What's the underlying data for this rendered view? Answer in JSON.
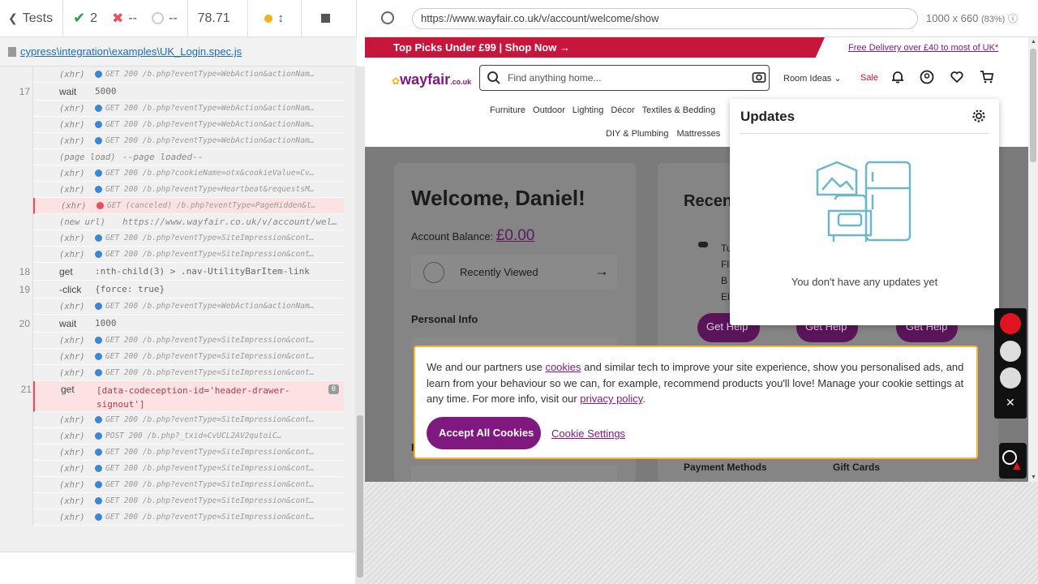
{
  "runner": {
    "tests_label": "Tests",
    "passed": "2",
    "failed": "--",
    "pending": "--",
    "duration": "78.71",
    "spec_path": "cypress\\integration\\examples\\UK_Login.spec.js"
  },
  "commands": [
    {
      "num": "",
      "name": "(xhr)",
      "msg": "GET 200 /b.php?eventType=WebAction&actionNam…",
      "dot": "blue",
      "type": "xhr"
    },
    {
      "num": "17",
      "name": "wait",
      "msg": "5000",
      "type": "cmd"
    },
    {
      "num": "",
      "name": "(xhr)",
      "msg": "GET 200 /b.php?eventType=WebAction&actionNam…",
      "dot": "blue",
      "type": "xhr"
    },
    {
      "num": "",
      "name": "(xhr)",
      "msg": "GET 200 /b.php?eventType=WebAction&actionNam…",
      "dot": "blue",
      "type": "xhr"
    },
    {
      "num": "",
      "name": "(xhr)",
      "msg": "GET 200 /b.php?eventType=WebAction&actionNam…",
      "dot": "blue",
      "type": "xhr"
    },
    {
      "num": "",
      "name": "(page load)",
      "msg": "--page loaded--",
      "type": "event"
    },
    {
      "num": "",
      "name": "(xhr)",
      "msg": "GET 200 /b.php?cookieName=otx&cookieValue=Cv…",
      "dot": "blue",
      "type": "xhr"
    },
    {
      "num": "",
      "name": "(xhr)",
      "msg": "GET 200 /b.php?eventType=Heartbeat&requestsM…",
      "dot": "blue",
      "type": "xhr"
    },
    {
      "num": "",
      "name": "(xhr)",
      "msg": "GET (canceled) /b.php?eventType=PageHidden&t…",
      "dot": "red",
      "type": "xhr",
      "err": true
    },
    {
      "num": "",
      "name": "(new url)",
      "msg": "https://www.wayfair.co.uk/v/account/wel…",
      "type": "event"
    },
    {
      "num": "",
      "name": "(xhr)",
      "msg": "GET 200 /b.php?eventType=SiteImpression&cont…",
      "dot": "blue",
      "type": "xhr"
    },
    {
      "num": "",
      "name": "(xhr)",
      "msg": "GET 200 /b.php?eventType=SiteImpression&cont…",
      "dot": "blue",
      "type": "xhr"
    },
    {
      "num": "18",
      "name": "get",
      "msg": ":nth-child(3) > .nav-UtilityBarItem-link",
      "type": "cmd"
    },
    {
      "num": "19",
      "name": "-click",
      "msg": "{force: true}",
      "type": "cmd"
    },
    {
      "num": "",
      "name": "(xhr)",
      "msg": "GET 200 /b.php?eventType=WebAction&actionNam…",
      "dot": "blue",
      "type": "xhr"
    },
    {
      "num": "20",
      "name": "wait",
      "msg": "1000",
      "type": "cmd"
    },
    {
      "num": "",
      "name": "(xhr)",
      "msg": "GET 200 /b.php?eventType=SiteImpression&cont…",
      "dot": "blue",
      "type": "xhr"
    },
    {
      "num": "",
      "name": "(xhr)",
      "msg": "GET 200 /b.php?eventType=SiteImpression&cont…",
      "dot": "blue",
      "type": "xhr"
    },
    {
      "num": "",
      "name": "(xhr)",
      "msg": "GET 200 /b.php?eventType=SiteImpression&cont…",
      "dot": "blue",
      "type": "xhr"
    },
    {
      "num": "21",
      "name": "get",
      "msg": "[data-codeception-id='header-drawer-signout']",
      "type": "cmd",
      "err": true,
      "badge": "0"
    },
    {
      "num": "",
      "name": "(xhr)",
      "msg": "GET 200 /b.php?eventType=SiteImpression&cont…",
      "dot": "blue",
      "type": "xhr"
    },
    {
      "num": "",
      "name": "(xhr)",
      "msg": "POST 200 /b.php?_txid=CvUCL2AV2qutoiC…",
      "dot": "blue",
      "type": "xhr"
    },
    {
      "num": "",
      "name": "(xhr)",
      "msg": "GET 200 /b.php?eventType=SiteImpression&cont…",
      "dot": "blue",
      "type": "xhr"
    },
    {
      "num": "",
      "name": "(xhr)",
      "msg": "GET 200 /b.php?eventType=SiteImpression&cont…",
      "dot": "blue",
      "type": "xhr"
    },
    {
      "num": "",
      "name": "(xhr)",
      "msg": "GET 200 /b.php?eventType=SiteImpression&cont…",
      "dot": "blue",
      "type": "xhr"
    },
    {
      "num": "",
      "name": "(xhr)",
      "msg": "GET 200 /b.php?eventType=SiteImpression&cont…",
      "dot": "blue",
      "type": "xhr"
    },
    {
      "num": "",
      "name": "(xhr)",
      "msg": "GET 200 /b.php?eventType=SiteImpression&cont…",
      "dot": "blue",
      "type": "xhr"
    }
  ],
  "browser": {
    "url": "https://www.wayfair.co.uk/v/account/welcome/show",
    "viewport": "1000 x 660",
    "scale": "(83%)"
  },
  "site": {
    "promo": "Top Picks Under £99 | Shop Now",
    "free_delivery": "Free Delivery over £40 to most of UK*",
    "logo": "wayfair",
    "logo_tld": ".co.uk",
    "search_placeholder": "Find anything home...",
    "room_ideas": "Room Ideas",
    "sale": "Sale",
    "nav1": [
      "Furniture",
      "Outdoor",
      "Lighting",
      "Décor",
      "Textiles & Bedding"
    ],
    "nav2": [
      "DIY & Plumbing",
      "Mattresses"
    ],
    "welcome": "Welcome, Daniel!",
    "balance_label": "Account Balance:",
    "balance_value": "£0.00",
    "recently_viewed": "Recently Viewed",
    "personal_info": "Personal Info",
    "recent_heading": "Recen",
    "recent_lines": [
      "Tu",
      "Fl",
      "B",
      "El"
    ],
    "get_help": "Get Help",
    "payment_methods": "Payment Methods",
    "gift_cards": "Gift Cards",
    "partial_label": "R"
  },
  "updates": {
    "title": "Updates",
    "message": "You don't have any updates yet"
  },
  "cookie": {
    "text_1": "We and our partners use ",
    "link_cookies": "cookies",
    "text_2": " and similar tech to improve your site experience, show you personalised ads, and learn from your behaviour so we can, for example, recommend products you'll love! Manage your cookie settings at any time. For more info, visit our ",
    "link_privacy": "privacy policy",
    "text_3": ".",
    "accept": "Accept All Cookies",
    "settings": "Cookie Settings"
  },
  "colors": {
    "brand": "#7f187f",
    "promo": "#c7163c",
    "pass": "#2e9e4a",
    "fail": "#e94f5b",
    "xhr_dot": "#3b87d4"
  }
}
